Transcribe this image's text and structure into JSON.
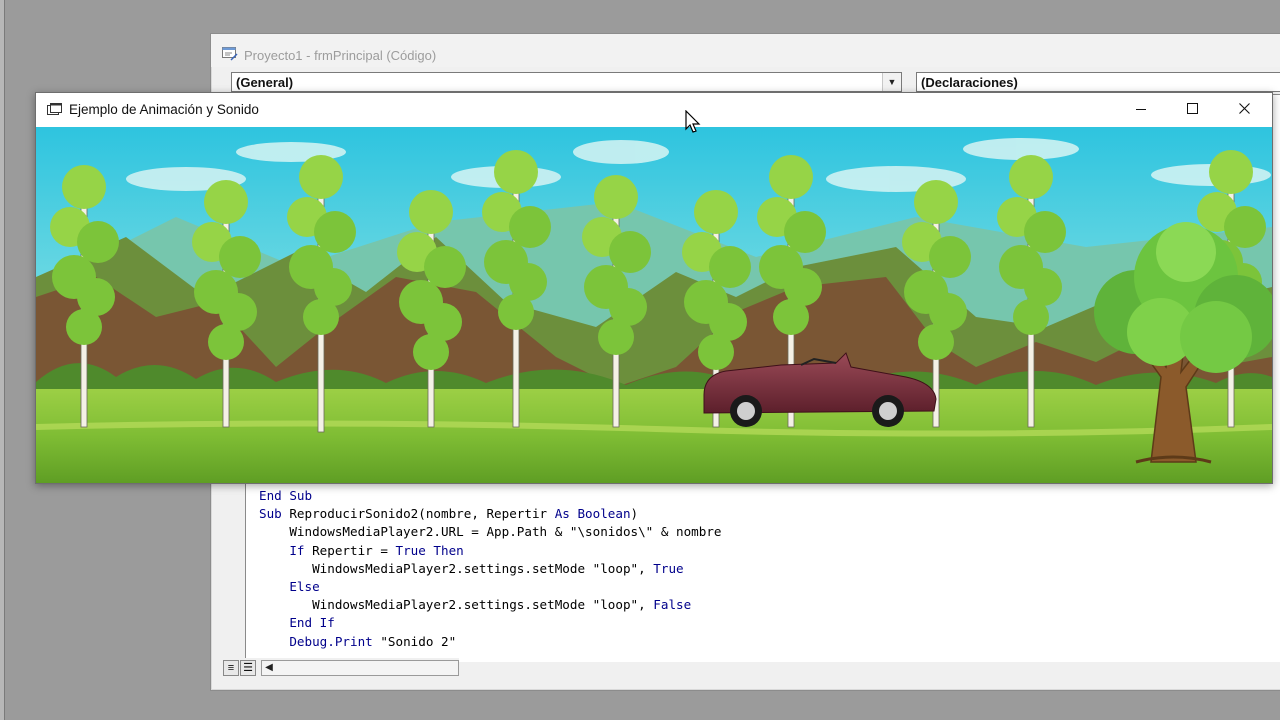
{
  "code_window": {
    "title": "Proyecto1 - frmPrincipal (Código)",
    "object_combo": "(General)",
    "procedure_combo": "(Declaraciones)"
  },
  "code_lines": [
    [
      {
        "t": "End Sub",
        "k": true
      }
    ],
    [
      {
        "t": "Sub ",
        "k": true
      },
      {
        "t": "ReproducirSonido2(nombre, Repertir "
      },
      {
        "t": "As Boolean",
        "k": true
      },
      {
        "t": ")"
      }
    ],
    [
      {
        "t": "    WindowsMediaPlayer2.URL = App.Path & \"\\sonidos\\\" & nombre"
      }
    ],
    [
      {
        "t": "    "
      },
      {
        "t": "If ",
        "k": true
      },
      {
        "t": "Repertir = "
      },
      {
        "t": "True Then",
        "k": true
      }
    ],
    [
      {
        "t": "       WindowsMediaPlayer2.settings.setMode \"loop\", "
      },
      {
        "t": "True",
        "k": true
      }
    ],
    [
      {
        "t": "    "
      },
      {
        "t": "Else",
        "k": true
      }
    ],
    [
      {
        "t": "       WindowsMediaPlayer2.settings.setMode \"loop\", "
      },
      {
        "t": "False",
        "k": true
      }
    ],
    [
      {
        "t": "    "
      },
      {
        "t": "End If",
        "k": true
      }
    ],
    [
      {
        "t": "    "
      },
      {
        "t": "Debug.Print",
        "k": true
      },
      {
        "t": " \"Sonido 2\""
      }
    ]
  ],
  "anim_window": {
    "title": "Ejemplo de Animación y Sonido",
    "minimize_glyph": "—",
    "maximize_glyph": "☐",
    "close_glyph": "✕"
  },
  "colors": {
    "keyword": "#00008b",
    "sky_top": "#2ec4df",
    "sky_bottom": "#b6f1e6",
    "grass": "#8ec63f",
    "car_body": "#7b2f3e"
  },
  "icons": {
    "code_window_icon": "vb-code-icon",
    "form_icon": "form-icon",
    "cursor": "mouse-pointer-icon"
  }
}
